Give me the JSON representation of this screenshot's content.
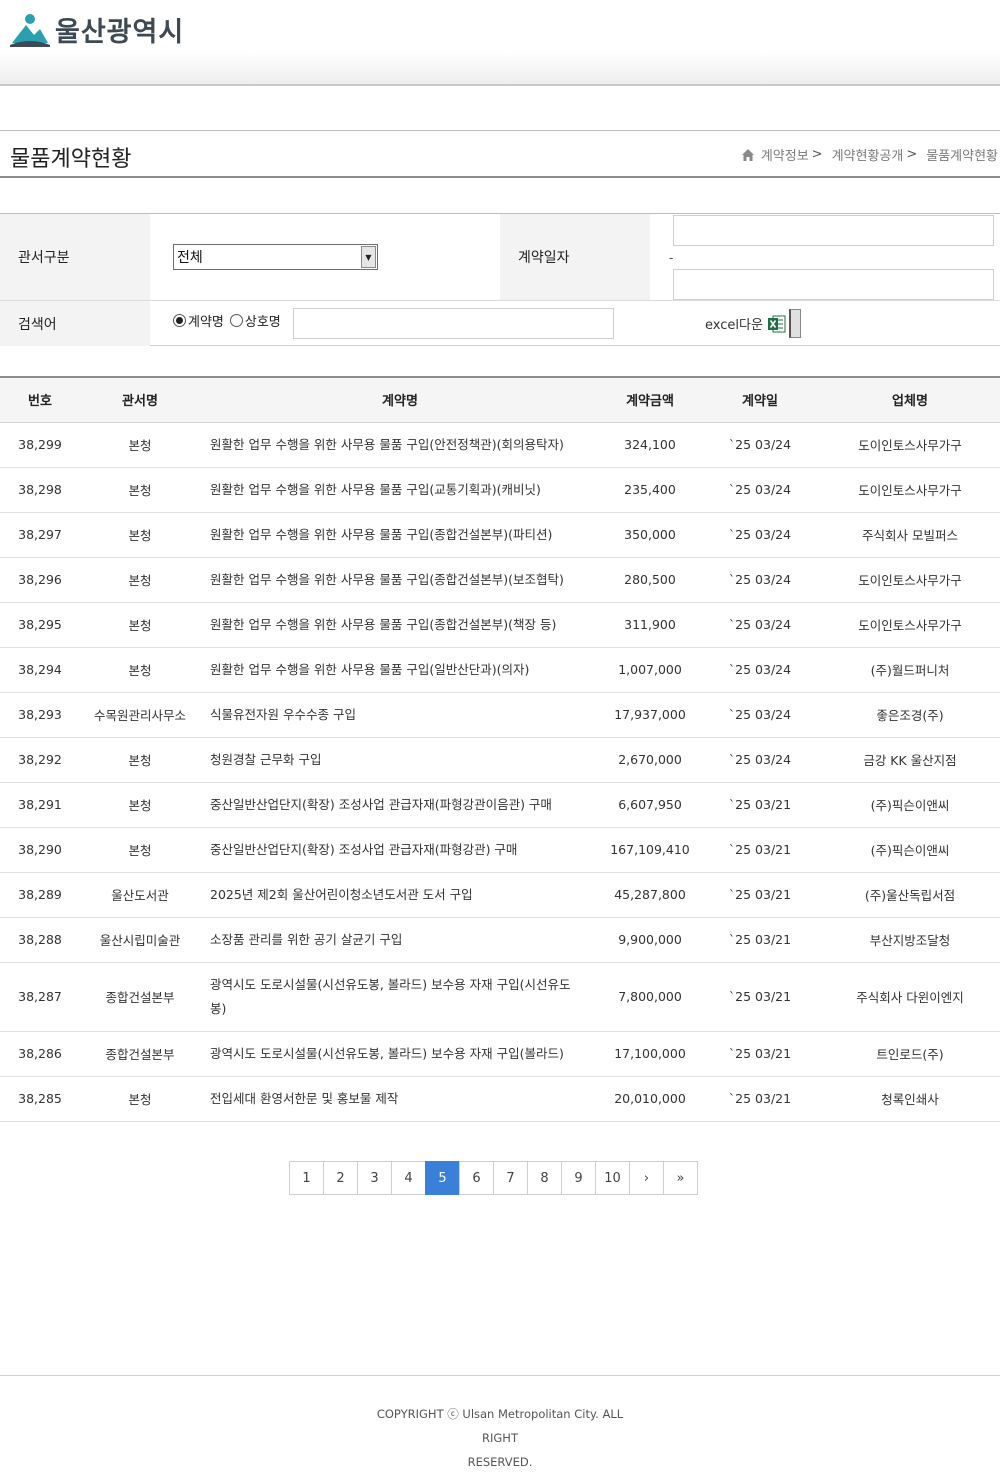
{
  "header": {
    "logo_text": "울산광역시"
  },
  "title_bar": {
    "title": "물품계약현황",
    "breadcrumb": [
      "계약정보",
      "계약현황공개",
      "물품계약현황"
    ],
    "sep": ">"
  },
  "search": {
    "dept_label": "관서구분",
    "dept_selected": "전체",
    "date_label": "계약일자",
    "date_dash": "-",
    "keyword_label": "검색어",
    "radio_contract": "계약명",
    "radio_company": "상호명",
    "excel_label": "excel다운"
  },
  "table": {
    "headers": [
      "번호",
      "관서명",
      "계약명",
      "계약금액",
      "계약일",
      "업체명"
    ],
    "rows": [
      {
        "no": "38,299",
        "dept": "본청",
        "name": "원활한 업무 수행을 위한 사무용 물품 구입(안전정책관)(회의용탁자)",
        "amount": "324,100",
        "date": "`25 03/24",
        "company": "도이인토스사무가구"
      },
      {
        "no": "38,298",
        "dept": "본청",
        "name": "원활한 업무 수행을 위한 사무용 물품 구입(교통기획과)(캐비닛)",
        "amount": "235,400",
        "date": "`25 03/24",
        "company": "도이인토스사무가구"
      },
      {
        "no": "38,297",
        "dept": "본청",
        "name": "원활한 업무 수행을 위한 사무용 물품 구입(종합건설본부)(파티션)",
        "amount": "350,000",
        "date": "`25 03/24",
        "company": "주식회사 모빌퍼스"
      },
      {
        "no": "38,296",
        "dept": "본청",
        "name": "원활한 업무 수행을 위한 사무용 물품 구입(종합건설본부)(보조협탁)",
        "amount": "280,500",
        "date": "`25 03/24",
        "company": "도이인토스사무가구"
      },
      {
        "no": "38,295",
        "dept": "본청",
        "name": "원활한 업무 수행을 위한 사무용 물품 구입(종합건설본부)(책장 등)",
        "amount": "311,900",
        "date": "`25 03/24",
        "company": "도이인토스사무가구"
      },
      {
        "no": "38,294",
        "dept": "본청",
        "name": "원활한 업무 수행을 위한 사무용 물품 구입(일반산단과)(의자)",
        "amount": "1,007,000",
        "date": "`25 03/24",
        "company": "(주)월드퍼니처"
      },
      {
        "no": "38,293",
        "dept": "수목원관리사무소",
        "name": "식물유전자원 우수수종 구입",
        "amount": "17,937,000",
        "date": "`25 03/24",
        "company": "좋은조경(주)"
      },
      {
        "no": "38,292",
        "dept": "본청",
        "name": "청원경찰 근무화 구입",
        "amount": "2,670,000",
        "date": "`25 03/24",
        "company": "금강 KK 울산지점"
      },
      {
        "no": "38,291",
        "dept": "본청",
        "name": "중산일반산업단지(확장) 조성사업 관급자재(파형강관이음관) 구매",
        "amount": "6,607,950",
        "date": "`25 03/21",
        "company": "(주)픽슨이앤씨"
      },
      {
        "no": "38,290",
        "dept": "본청",
        "name": "중산일반산업단지(확장) 조성사업 관급자재(파형강관) 구매",
        "amount": "167,109,410",
        "date": "`25 03/21",
        "company": "(주)픽슨이앤씨"
      },
      {
        "no": "38,289",
        "dept": "울산도서관",
        "name": "2025년 제2회 울산어린이청소년도서관 도서 구입",
        "amount": "45,287,800",
        "date": "`25 03/21",
        "company": "(주)울산독립서점"
      },
      {
        "no": "38,288",
        "dept": "울산시립미술관",
        "name": "소장품 관리를 위한 공기 살균기 구입",
        "amount": "9,900,000",
        "date": "`25 03/21",
        "company": "부산지방조달청"
      },
      {
        "no": "38,287",
        "dept": "종합건설본부",
        "name": "광역시도 도로시설물(시선유도봉, 볼라드) 보수용 자재 구입(시선유도봉)",
        "amount": "7,800,000",
        "date": "`25 03/21",
        "company": "주식회사 다윈이엔지",
        "tall": true
      },
      {
        "no": "38,286",
        "dept": "종합건설본부",
        "name": "광역시도 도로시설물(시선유도봉, 볼라드) 보수용 자재 구입(볼라드)",
        "amount": "17,100,000",
        "date": "`25 03/21",
        "company": "트인로드(주)"
      },
      {
        "no": "38,285",
        "dept": "본청",
        "name": "전입세대 환영서한문 및 홍보물 제작",
        "amount": "20,010,000",
        "date": "`25 03/21",
        "company": "청록인쇄사"
      }
    ]
  },
  "pagination": {
    "pages": [
      "1",
      "2",
      "3",
      "4",
      "5",
      "6",
      "7",
      "8",
      "9",
      "10"
    ],
    "current": "5",
    "next": "›",
    "last": "»"
  },
  "footer": {
    "line1": "COPYRIGHT ⓒ Ulsan Metropolitan City. ALL RIGHT",
    "line2": "RESERVED."
  },
  "colors": {
    "active_page": "#3a7fd8",
    "logo_teal": "#2a9fb0",
    "logo_text": "#3e4a53"
  }
}
